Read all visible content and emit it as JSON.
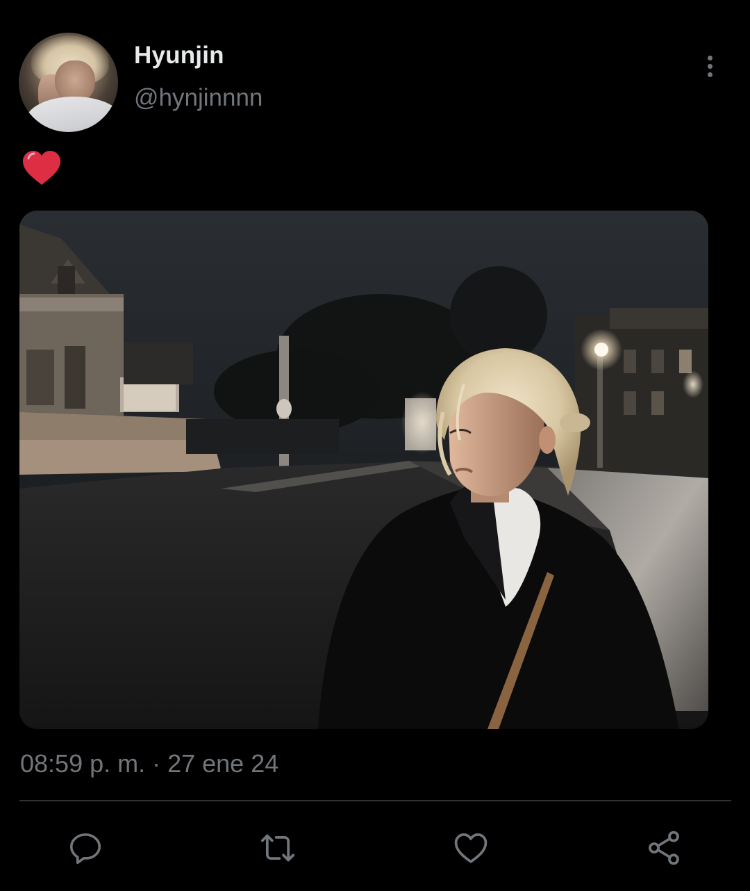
{
  "author": {
    "display_name": "Hyunjin",
    "handle": "@hynjinnnn"
  },
  "tweet": {
    "text_emoji": "heart-emoji",
    "timestamp": "08:59 p. m. · 27 ene 24"
  },
  "actions": {
    "items": [
      "reply-icon",
      "retweet-icon",
      "like-icon",
      "share-icon"
    ]
  },
  "menu": {
    "icon": "more-vertical-icon"
  },
  "colors": {
    "background": "#000000",
    "primary_text": "#e7e9ea",
    "secondary_text": "#71767b",
    "divider": "#2f3336",
    "heart_emoji": "#dd2e44"
  }
}
